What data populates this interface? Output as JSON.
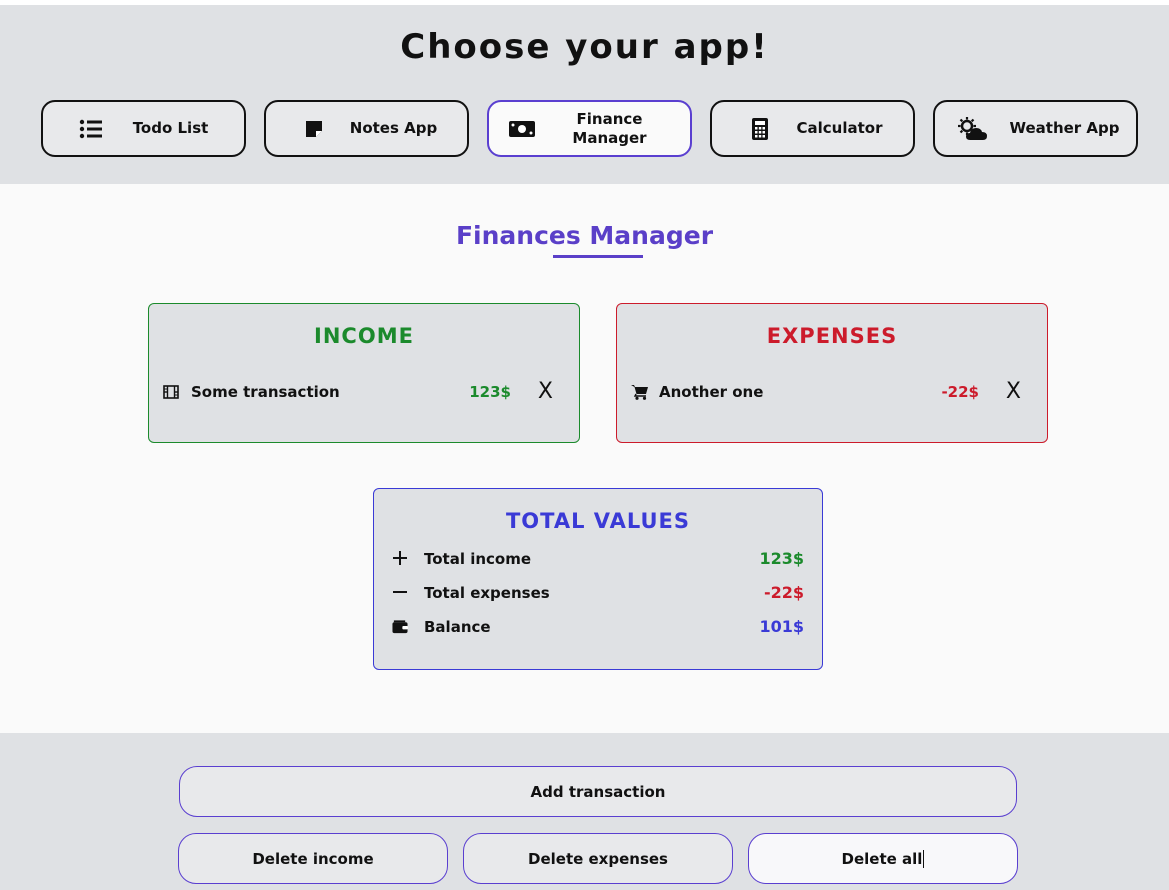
{
  "header": {
    "title": "Choose your app!"
  },
  "apps": [
    {
      "label": "Todo List",
      "icon": "list-icon"
    },
    {
      "label": "Notes App",
      "icon": "sticky-note-icon"
    },
    {
      "label": "Finance\nManager",
      "icon": "money-bill-icon"
    },
    {
      "label": "Calculator",
      "icon": "calculator-icon"
    },
    {
      "label": "Weather App",
      "icon": "cloud-sun-icon"
    }
  ],
  "finance": {
    "title": "Finances Manager",
    "income": {
      "title": "INCOME",
      "items": [
        {
          "name": "Some transaction",
          "amount": "123$",
          "icon": "film-icon",
          "delete": "X"
        }
      ]
    },
    "expenses": {
      "title": "EXPENSES",
      "items": [
        {
          "name": "Another one",
          "amount": "-22$",
          "icon": "cart-icon",
          "delete": "X"
        }
      ]
    },
    "totals": {
      "title": "TOTAL VALUES",
      "rows": [
        {
          "label": "Total income",
          "value": "123$",
          "icon": "plus-icon"
        },
        {
          "label": "Total expenses",
          "value": "-22$",
          "icon": "minus-icon"
        },
        {
          "label": "Balance",
          "value": "101$",
          "icon": "wallet-icon"
        }
      ]
    }
  },
  "actions": {
    "add": "Add transaction",
    "delete_income": "Delete income",
    "delete_expenses": "Delete expenses",
    "delete_all": "Delete all"
  },
  "colors": {
    "income": "#1b8a2c",
    "expenses": "#cc1b2b",
    "total": "#3a3ad6",
    "accent": "#5a3fc8"
  }
}
